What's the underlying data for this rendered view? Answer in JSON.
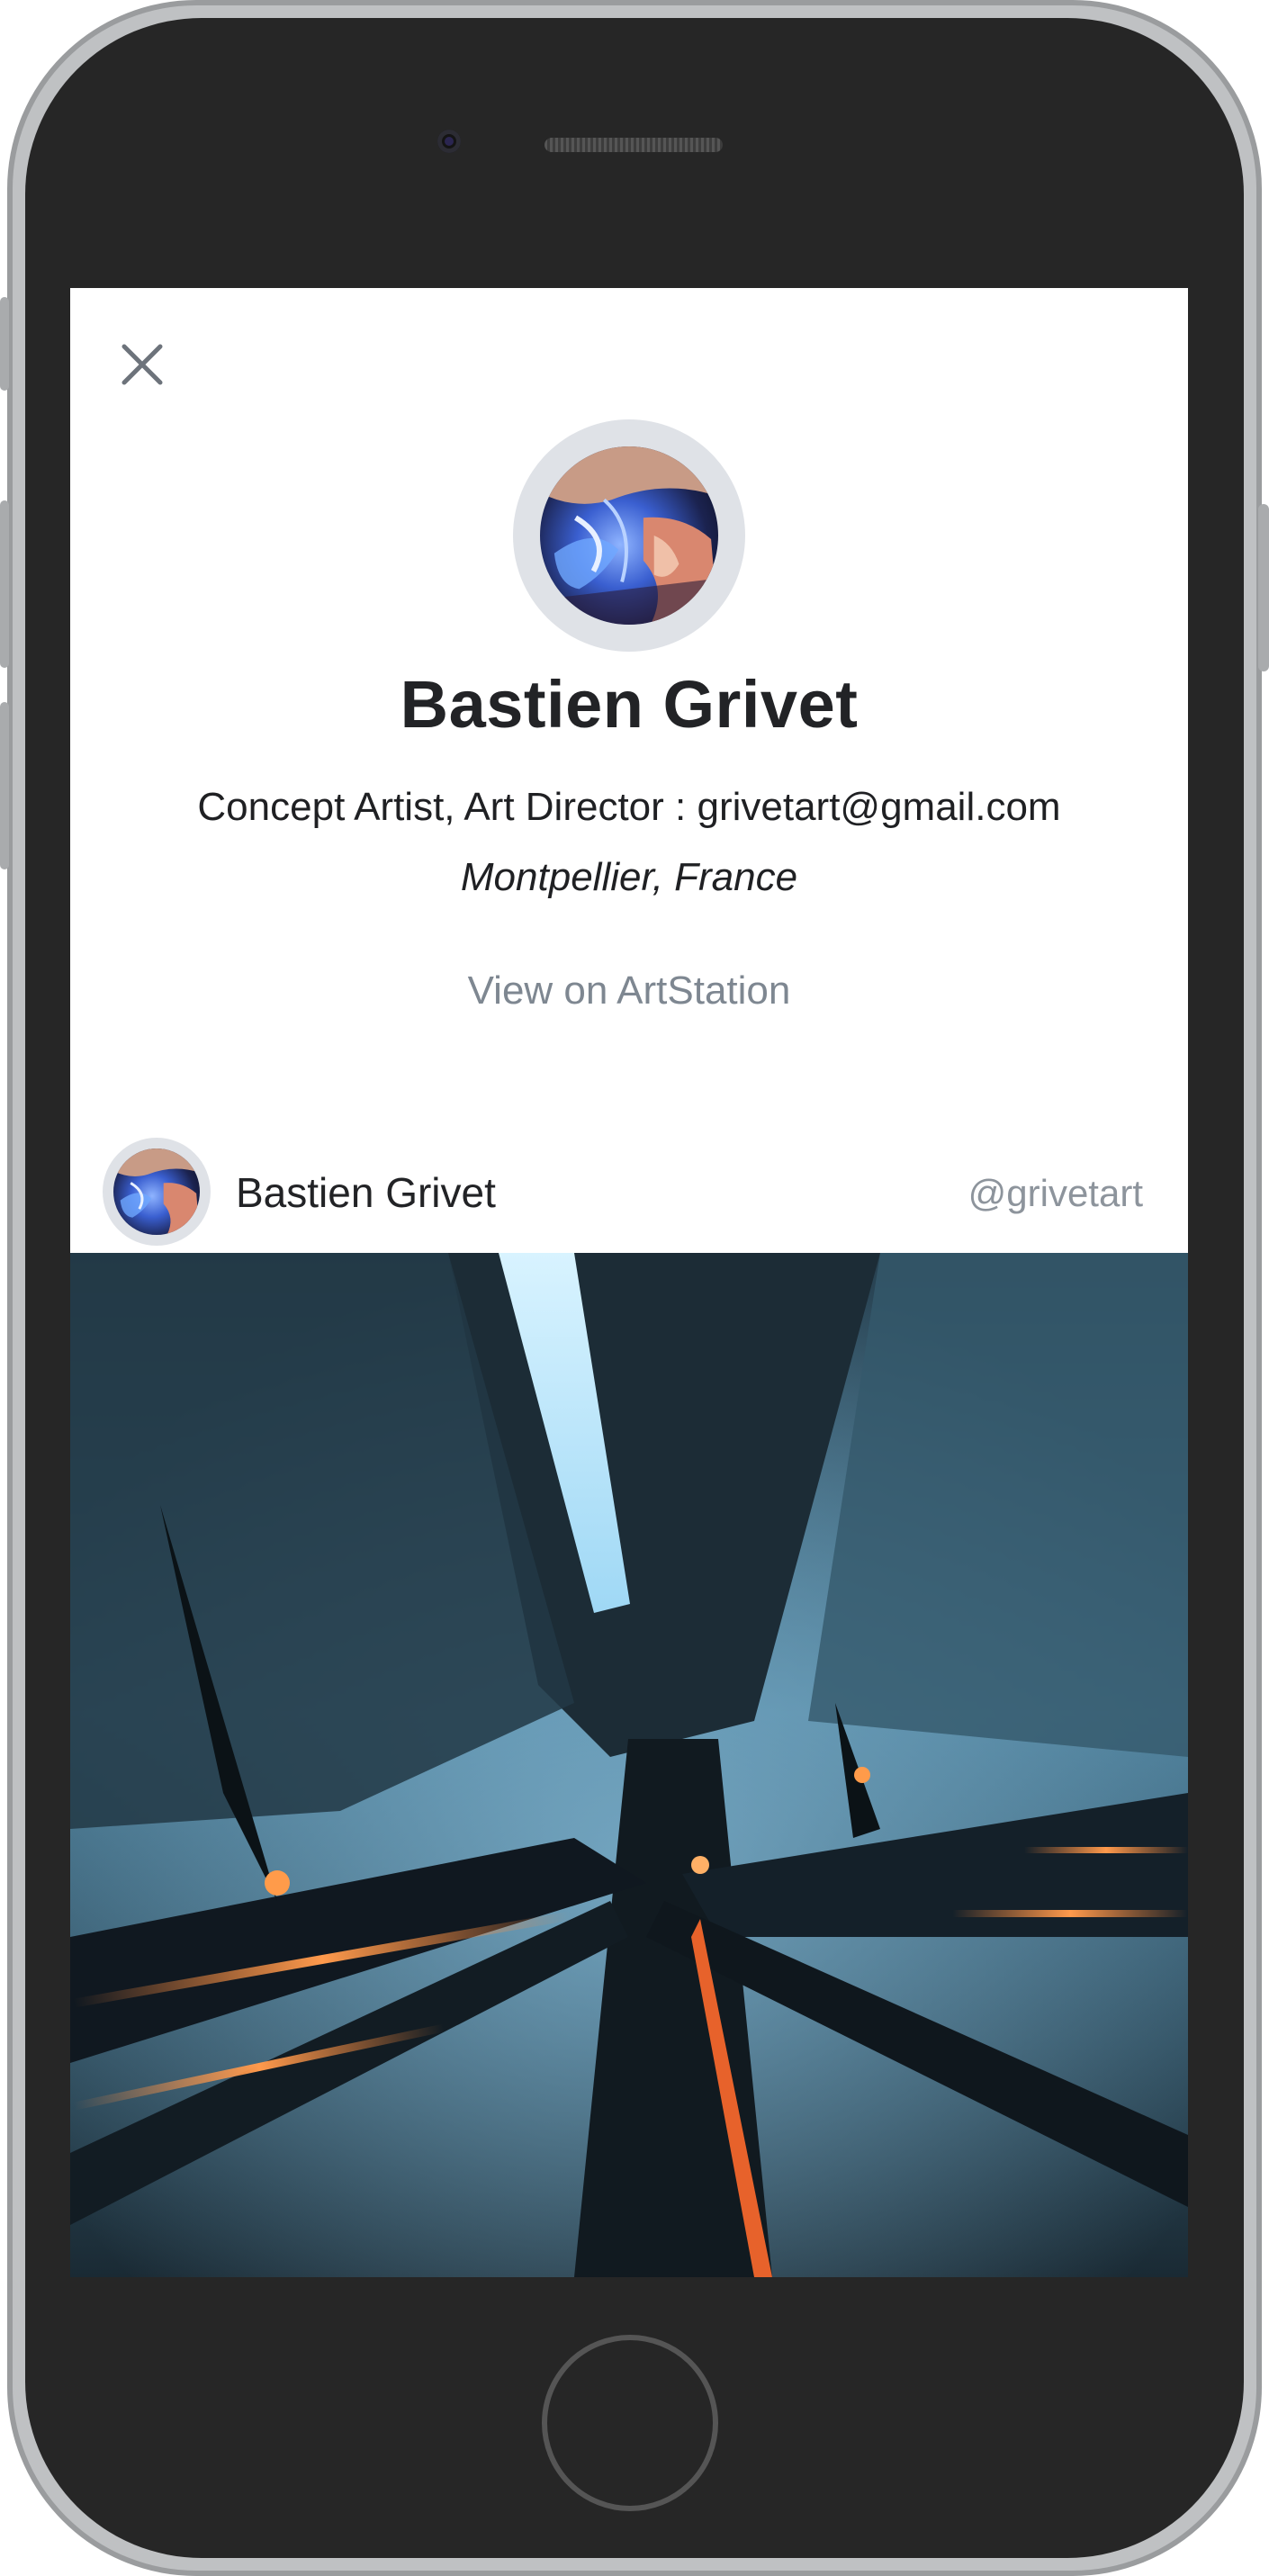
{
  "device": {
    "frame_color": "#bfc1c3",
    "body_color": "#262626",
    "screen_background": "#ffffff"
  },
  "profile": {
    "close_icon": "close-icon",
    "name": "Bastien Grivet",
    "headline": "Concept Artist, Art Director : grivetart@gmail.com",
    "location": "Montpellier, France",
    "link_label": "View on ArtStation",
    "link_color": "#7e8791"
  },
  "post": {
    "author_name": "Bastien Grivet",
    "author_handle": "@grivetart"
  }
}
